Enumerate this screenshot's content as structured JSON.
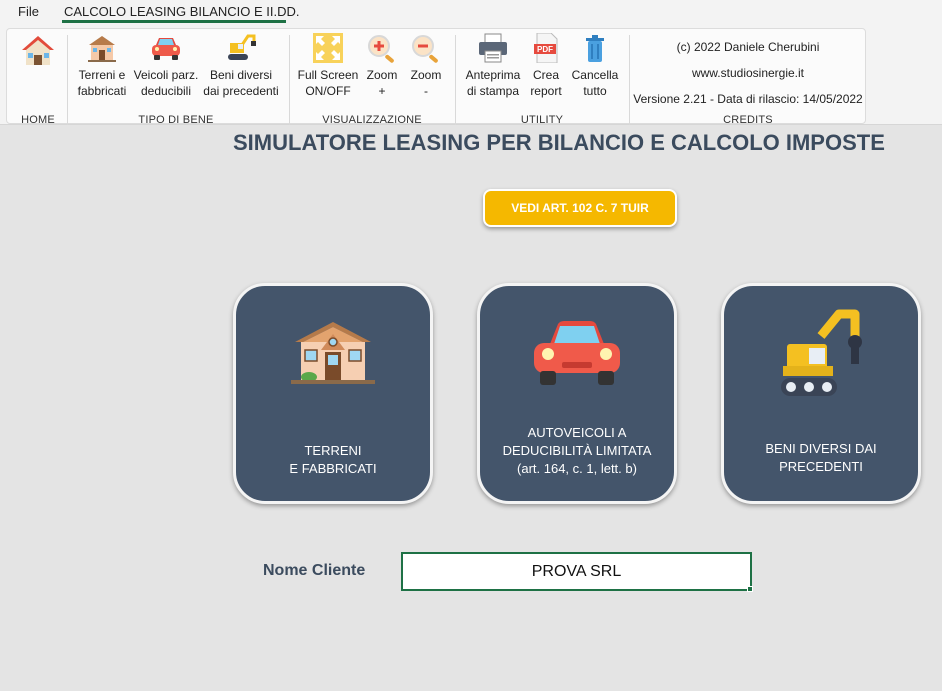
{
  "menubar": {
    "file": "File",
    "tab": "CALCOLO LEASING BILANCIO E II.DD."
  },
  "ribbon": {
    "home": {
      "label": "HOME",
      "group": "HOME"
    },
    "tipo_bene": {
      "group": "TIPO DI BENE",
      "buttons": [
        {
          "line1": "Terreni e",
          "line2": "fabbricati"
        },
        {
          "line1": "Veicoli parz.",
          "line2": "deducibili"
        },
        {
          "line1": "Beni diversi",
          "line2": "dai precedenti"
        }
      ]
    },
    "visualizzazione": {
      "group": "VISUALIZZAZIONE",
      "buttons": [
        {
          "line1": "Full Screen",
          "line2": "ON/OFF"
        },
        {
          "line1": "Zoom",
          "line2": "+"
        },
        {
          "line1": "Zoom",
          "line2": "-"
        }
      ]
    },
    "utility": {
      "group": "UTILITY",
      "buttons": [
        {
          "line1": "Anteprima",
          "line2": "di stampa"
        },
        {
          "line1": "Crea",
          "line2": "report"
        },
        {
          "line1": "Cancella",
          "line2": "tutto"
        }
      ],
      "pdf_text": "PDF"
    },
    "credits": {
      "group": "CREDITS",
      "author": "(c) 2022 Daniele Cherubini",
      "website": "www.studiosinergie.it",
      "version": "Versione 2.21 - Data di rilascio: 14/05/2022"
    }
  },
  "main": {
    "title": "SIMULATORE LEASING PER BILANCIO E CALCOLO IMPOSTE",
    "art_button": "VEDI ART. 102 C. 7 TUIR",
    "cards": [
      {
        "lines": [
          "TERRENI",
          "E FABBRICATI"
        ]
      },
      {
        "lines": [
          "AUTOVEICOLI A",
          "DEDUCIBILITÀ LIMITATA",
          "(art. 164, c. 1, lett. b)"
        ]
      },
      {
        "lines": [
          "BENI DIVERSI DAI",
          "PRECEDENTI"
        ]
      }
    ],
    "client_label": "Nome Cliente",
    "client_value": "PROVA SRL"
  },
  "colors": {
    "accent_green": "#1e7145",
    "card_bg": "#44556b",
    "title_color": "#3b4b5e",
    "art_button_bg": "#f5b800"
  }
}
